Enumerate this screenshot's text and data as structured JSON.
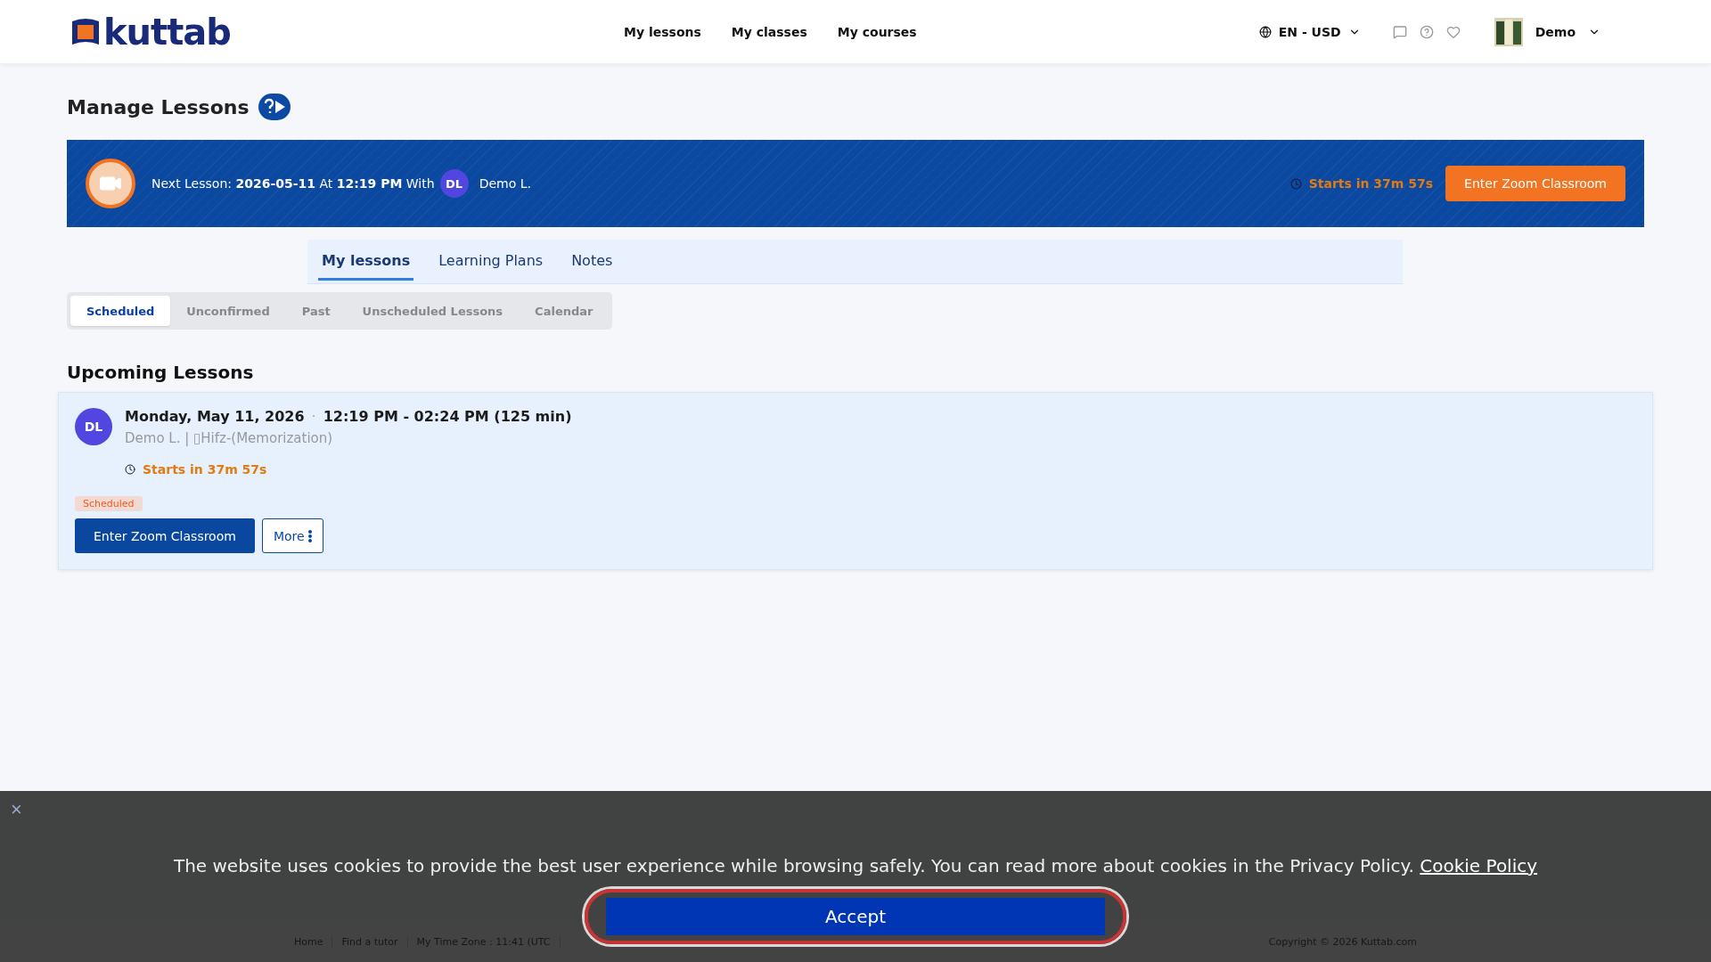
{
  "header": {
    "logo": "kuttab",
    "nav": [
      "My lessons",
      "My classes",
      "My courses"
    ],
    "locale": "EN - USD",
    "user": "Demo"
  },
  "page": {
    "title": "Manage Lessons"
  },
  "next_lesson": {
    "label": "Next Lesson:",
    "date": "2026-05-11",
    "at": "At",
    "time": "12:19 PM",
    "with": "With",
    "initials": "DL",
    "tutor": "Demo L.",
    "countdown": "Starts in 37m 57s",
    "button": "Enter Zoom Classroom"
  },
  "tabs": [
    {
      "label": "My lessons",
      "selected": true
    },
    {
      "label": "Learning Plans",
      "selected": false
    },
    {
      "label": "Notes",
      "selected": false
    }
  ],
  "subtabs": [
    {
      "label": "Scheduled",
      "selected": true
    },
    {
      "label": "Unconfirmed",
      "selected": false
    },
    {
      "label": "Past",
      "selected": false
    },
    {
      "label": "Unscheduled Lessons",
      "selected": false
    },
    {
      "label": "Calendar",
      "selected": false
    }
  ],
  "section_title": "Upcoming Lessons",
  "lessons": [
    {
      "initials": "DL",
      "date": "Monday, May 11, 2026",
      "time": "12:19 PM - 02:24 PM (125 min)",
      "separator": "·",
      "subtitle": "Demo L. | ▯Hifz-(Memorization)",
      "countdown": "Starts in 37m 57s",
      "status": "Scheduled",
      "button": "Enter Zoom Classroom",
      "more": "More"
    }
  ],
  "footer": {
    "links": [
      "Home",
      "Find a tutor",
      "My Time Zone : 11:41 (UTC"
    ],
    "copyright": "Copyright © 2026 Kuttab.com"
  },
  "cookie": {
    "close": "×",
    "text": "The website uses cookies to provide the best user experience while browsing safely. You can read more about cookies in the Privacy Policy.",
    "link": "Cookie Policy",
    "button": "Accept"
  }
}
